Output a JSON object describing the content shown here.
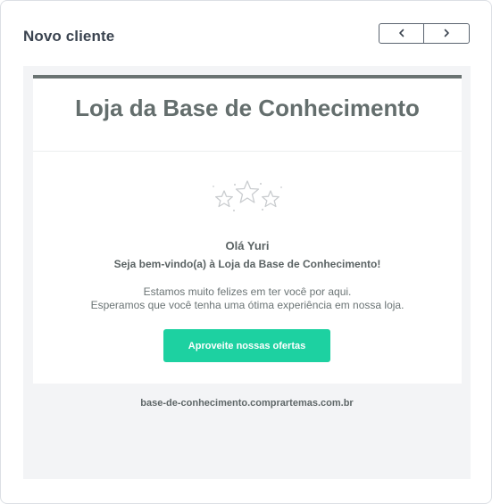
{
  "card": {
    "title": "Novo cliente"
  },
  "nav": {
    "prev_icon": "chevron-left-icon",
    "next_icon": "chevron-right-icon"
  },
  "email": {
    "store_title": "Loja da Base de Conhecimento",
    "decoration_icon": "stars-icon",
    "greeting": "Olá Yuri",
    "welcome": "Seja bem-vindo(a) à Loja da Base de Conhecimento!",
    "body_line_1": "Estamos muito felizes em ter você por aqui.",
    "body_line_2": "Esperamos que você tenha uma ótima experiência em nossa loja.",
    "cta_label": "Aproveite nossas ofertas",
    "footer_url": "base-de-conhecimento.comprartemas.com.br"
  },
  "colors": {
    "accent": "#1dd1a1",
    "header_bar": "#6a7372",
    "preview_bg": "#f3f4f6"
  }
}
